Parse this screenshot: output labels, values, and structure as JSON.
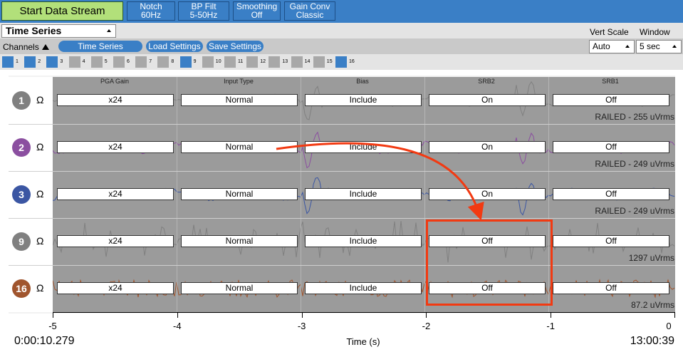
{
  "toolbar": {
    "start_label": "Start Data Stream",
    "notch": [
      "Notch",
      "60Hz"
    ],
    "bp_filt": [
      "BP Filt",
      "5-50Hz"
    ],
    "smoothing": [
      "Smoothing",
      "Off"
    ],
    "gain_conv": [
      "Gain Conv",
      "Classic"
    ]
  },
  "widget": {
    "selector_value": "Time Series",
    "vert_scale_label": "Vert Scale",
    "window_label": "Window",
    "vert_scale_value": "Auto",
    "window_value": "5 sec"
  },
  "subbar": {
    "channels_label": "Channels",
    "tabs": [
      "Time Series",
      "Load Settings",
      "Save Settings"
    ]
  },
  "channel_toggles": [
    {
      "n": "1",
      "on": true
    },
    {
      "n": "2",
      "on": true
    },
    {
      "n": "3",
      "on": true
    },
    {
      "n": "4",
      "on": false
    },
    {
      "n": "5",
      "on": false
    },
    {
      "n": "6",
      "on": false
    },
    {
      "n": "7",
      "on": false
    },
    {
      "n": "8",
      "on": false
    },
    {
      "n": "9",
      "on": true
    },
    {
      "n": "10",
      "on": false
    },
    {
      "n": "11",
      "on": false
    },
    {
      "n": "12",
      "on": false
    },
    {
      "n": "13",
      "on": false
    },
    {
      "n": "14",
      "on": false
    },
    {
      "n": "15",
      "on": false
    },
    {
      "n": "16",
      "on": true
    }
  ],
  "columns": [
    "PGA Gain",
    "Input Type",
    "Bias",
    "SRB2",
    "SRB1"
  ],
  "rows": [
    {
      "channel": "1",
      "color": "#808080",
      "values": [
        "x24",
        "Normal",
        "Include",
        "On",
        "Off"
      ],
      "status": "RAILED - 255 uVrms"
    },
    {
      "channel": "2",
      "color": "#8b4fa0",
      "values": [
        "x24",
        "Normal",
        "Include",
        "On",
        "Off"
      ],
      "status": "RAILED - 249 uVrms"
    },
    {
      "channel": "3",
      "color": "#3b56a3",
      "values": [
        "x24",
        "Normal",
        "Include",
        "On",
        "Off"
      ],
      "status": "RAILED - 249 uVrms"
    },
    {
      "channel": "9",
      "color": "#808080",
      "values": [
        "x24",
        "Normal",
        "Include",
        "Off",
        "Off"
      ],
      "status": "1297 uVrms"
    },
    {
      "channel": "16",
      "color": "#a0552e",
      "values": [
        "x24",
        "Normal",
        "Include",
        "Off",
        "Off"
      ],
      "status": "87.2 uVrms"
    }
  ],
  "omega_symbol": "Ω",
  "axis": {
    "ticks": [
      "-5",
      "-4",
      "-3",
      "-2",
      "-1",
      "0"
    ],
    "xlabel": "Time (s)"
  },
  "footer": {
    "elapsed": "0:00:10.279",
    "clock": "13:00:39"
  },
  "annotation_color": "#f23a12"
}
